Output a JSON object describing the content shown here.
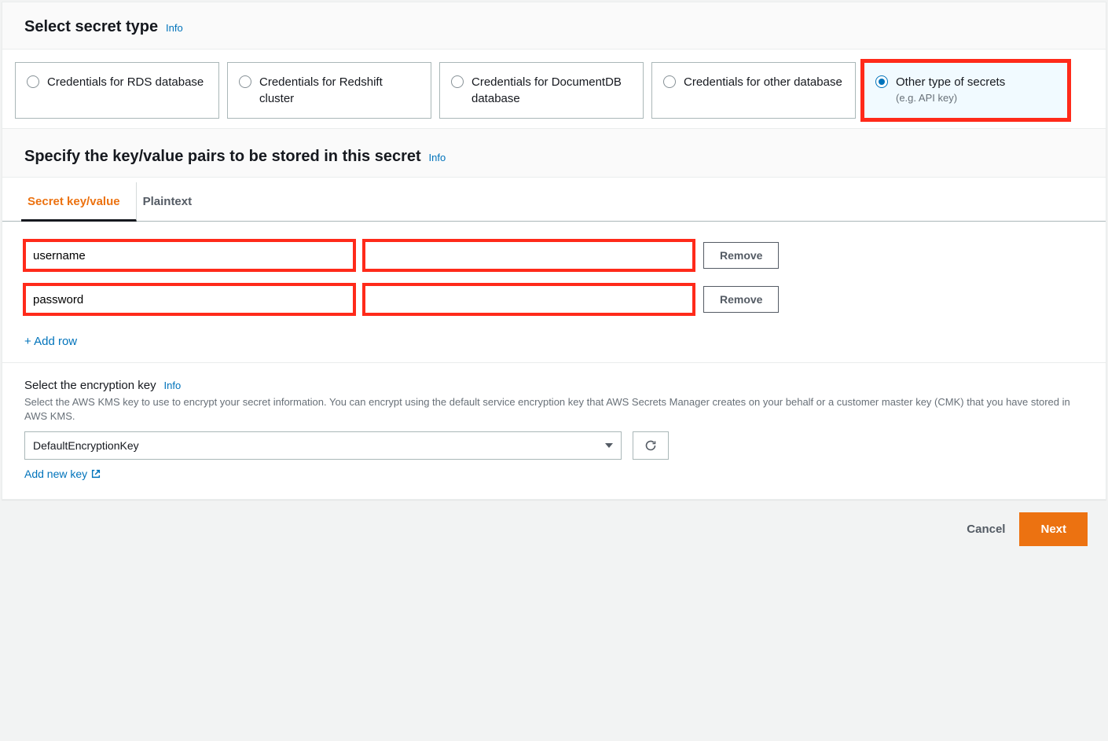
{
  "header": {
    "title": "Select secret type",
    "info": "Info"
  },
  "secret_types": [
    {
      "label": "Credentials for RDS database",
      "selected": false
    },
    {
      "label": "Credentials for Redshift cluster",
      "selected": false
    },
    {
      "label": "Credentials for DocumentDB database",
      "selected": false
    },
    {
      "label": "Credentials for other database",
      "selected": false
    },
    {
      "label": "Other type of secrets",
      "sub": "(e.g. API key)",
      "selected": true
    }
  ],
  "kv": {
    "title": "Specify the key/value pairs to be stored in this secret",
    "info": "Info",
    "tabs": [
      {
        "label": "Secret key/value",
        "active": true
      },
      {
        "label": "Plaintext",
        "active": false
      }
    ],
    "rows": [
      {
        "key": "username",
        "value": ""
      },
      {
        "key": "password",
        "value": ""
      }
    ],
    "remove_label": "Remove",
    "add_row_label": "+ Add row"
  },
  "encryption": {
    "label": "Select the encryption key",
    "info": "Info",
    "desc": "Select the AWS KMS key to use to encrypt your secret information. You can encrypt using the default service encryption key that AWS Secrets Manager creates on your behalf or a customer master key (CMK) that you have stored in AWS KMS.",
    "selected": "DefaultEncryptionKey",
    "add_new_key": "Add new key"
  },
  "footer": {
    "cancel": "Cancel",
    "next": "Next"
  }
}
